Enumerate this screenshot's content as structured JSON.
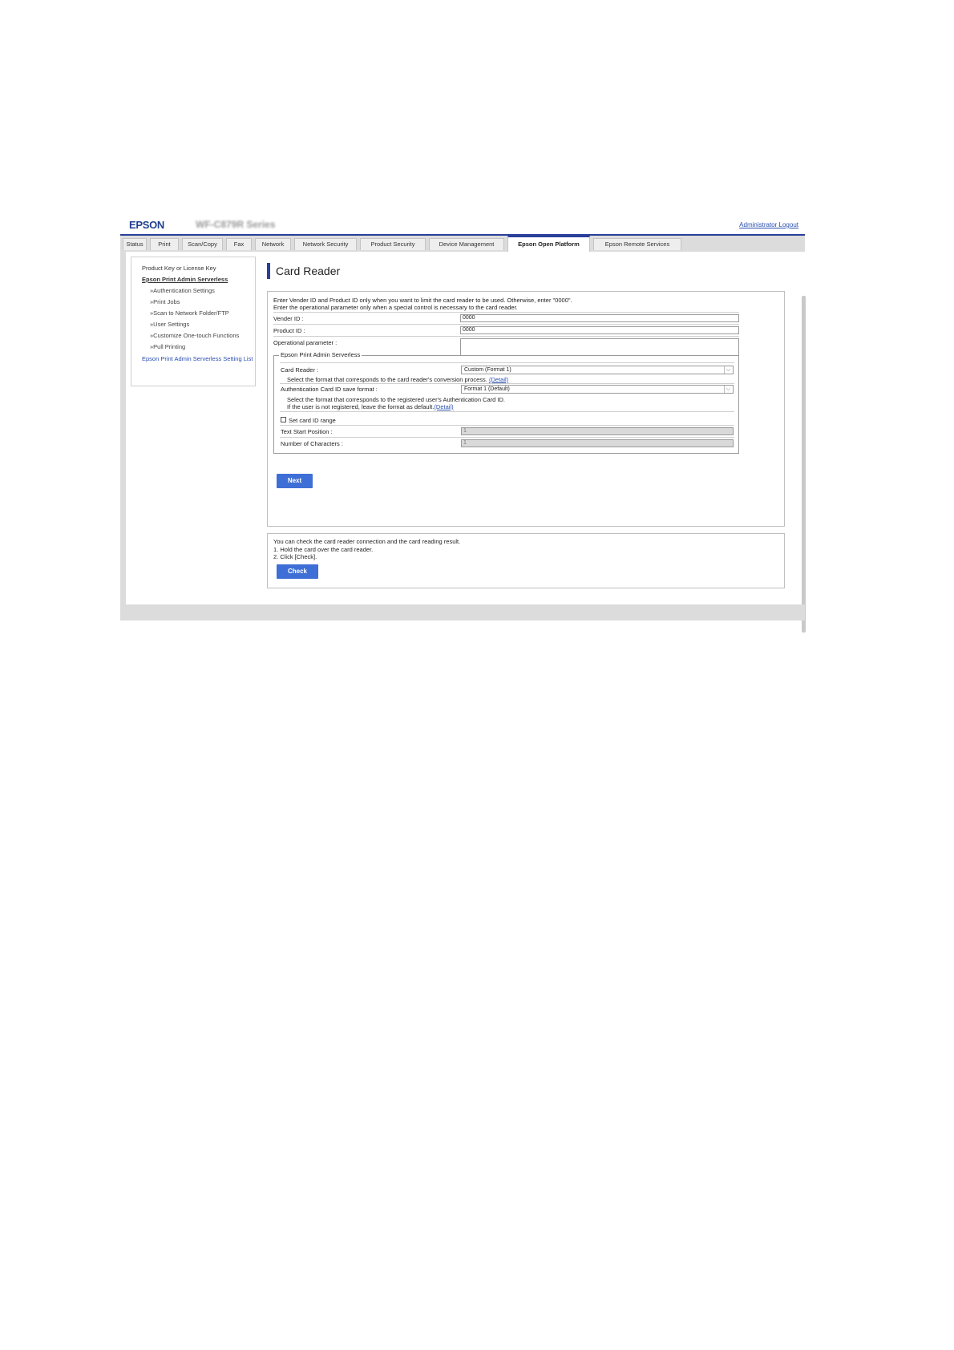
{
  "header": {
    "brand": "EPSON",
    "model": "WF-C879R Series",
    "logout": "Administrator Logout"
  },
  "tabs": [
    {
      "label": "Status"
    },
    {
      "label": "Print"
    },
    {
      "label": "Scan/Copy"
    },
    {
      "label": "Fax"
    },
    {
      "label": "Network"
    },
    {
      "label": "Network Security"
    },
    {
      "label": "Product Security"
    },
    {
      "label": "Device Management"
    },
    {
      "label": "Epson Open Platform",
      "active": true
    },
    {
      "label": "Epson Remote Services"
    }
  ],
  "sidebar": {
    "items": [
      {
        "label": "Product Key or License Key"
      },
      {
        "label": "Epson Print Admin Serverless"
      },
      {
        "label": "»Authentication Settings"
      },
      {
        "label": "»Print Jobs"
      },
      {
        "label": "»Scan to Network Folder/FTP"
      },
      {
        "label": "»User Settings"
      },
      {
        "label": "»Customize One-touch Functions"
      },
      {
        "label": "»Pull Printing"
      },
      {
        "label": "Epson Print Admin Serverless Setting List"
      }
    ]
  },
  "page": {
    "title": "Card Reader",
    "intro1": "Enter Vender ID and Product ID only when you want to limit the card reader to be used. Otherwise, enter \"0000\".",
    "intro2": "Enter the operational parameter only when a special control is necessary to the card reader.",
    "vendor_label": "Vender ID :",
    "vendor_value": "0000",
    "product_label": "Product ID :",
    "product_value": "0000",
    "param_label": "Operational parameter :",
    "param_value": "",
    "group_title": "Epson Print Admin Serverless",
    "card_reader_label": "Card Reader :",
    "card_reader_value": "Custom (Format 1)",
    "card_reader_help": "Select the format that corresponds to the card reader's conversion process.",
    "detail_link": "(Detail)",
    "save_format_label": "Authentication Card ID save format :",
    "save_format_value": "Format 1 (Default)",
    "save_format_help1": "Select the format that corresponds to the registered user's Authentication Card ID.",
    "save_format_help2": "If the user is not registered, leave the format as default.",
    "set_range_label": "Set card ID range",
    "set_range_checked": false,
    "start_pos_label": "Text Start Position :",
    "start_pos_value": "1",
    "num_chars_label": "Number of Characters :",
    "num_chars_value": "1",
    "next_button": "Next"
  },
  "check_panel": {
    "line1": "You can check the card reader connection and the card reading result.",
    "line2": "1. Hold the card over the card reader.",
    "line3": "2. Click [Check].",
    "check_button": "Check"
  }
}
